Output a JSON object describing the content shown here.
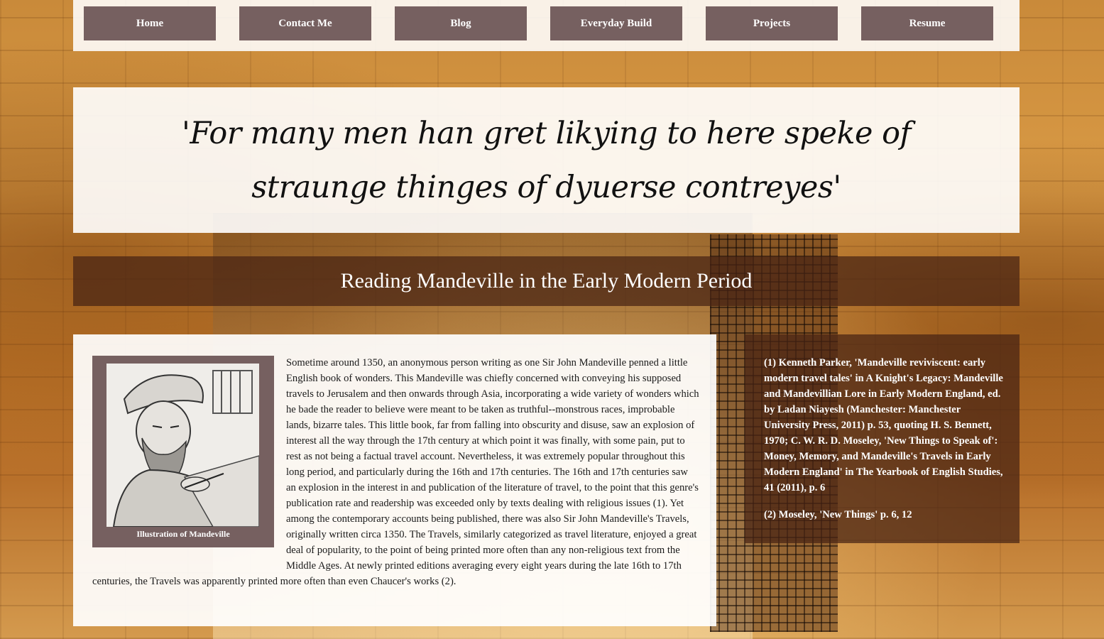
{
  "nav": {
    "items": [
      "Home",
      "Contact Me",
      "Blog",
      "Everyday Build",
      "Projects",
      "Resume"
    ]
  },
  "quote": "'For many men han gret likying to here speke of straunge thinges of dyuerse contreyes'",
  "title": "Reading Mandeville in the Early Modern Period",
  "figure": {
    "caption": "Illustration of Mandeville"
  },
  "article": {
    "body": "Sometime around 1350, an anonymous person writing as one Sir John Mandeville penned a little English book of wonders. This Mandeville was chiefly concerned with conveying his supposed travels to Jerusalem and then onwards through Asia, incorporating a wide variety of wonders which he bade the reader to believe were meant to be taken as truthful--monstrous races, improbable lands, bizarre tales. This little book, far from falling into obscurity and disuse, saw an explosion of interest all the way through the 17th century at which point it was finally, with some pain, put to rest as not being a factual travel account. Nevertheless, it was extremely popular throughout this long period, and particularly during the 16th and 17th centuries. The 16th and 17th centuries saw an explosion in the interest in and publication of the literature of travel, to the point that this genre's publication rate and readership was exceeded only by texts dealing with religious issues (1). Yet among the contemporary accounts being published, there was also Sir John Mandeville's Travels, originally written circa 1350. The Travels, similarly categorized as travel literature, enjoyed a great deal of popularity, to the point of being printed more often than any non-religious text from the Middle Ages. At newly printed editions averaging every eight years during the late 16th to 17th centuries, the Travels was apparently printed more often than even Chaucer's works (2)."
  },
  "notes": [
    "(1) Kenneth Parker, 'Mandeville reviviscent: early modern travel tales' in A Knight's Legacy: Mandeville and Mandevillian Lore in Early Modern England, ed. by Ladan Niayesh (Manchester: Manchester University Press, 2011) p. 53, quoting H. S. Bennett, 1970; C. W. R. D. Moseley, 'New Things to Speak of': Money, Memory, and Mandeville's Travels in Early Modern England' in The Yearbook of English Studies, 41 (2011), p. 6",
    "(2) Moseley, 'New Things' p. 6, 12"
  ],
  "colors": {
    "nav_button": "#766060",
    "title_bar": "#46231499",
    "panel": "#ffffff"
  }
}
